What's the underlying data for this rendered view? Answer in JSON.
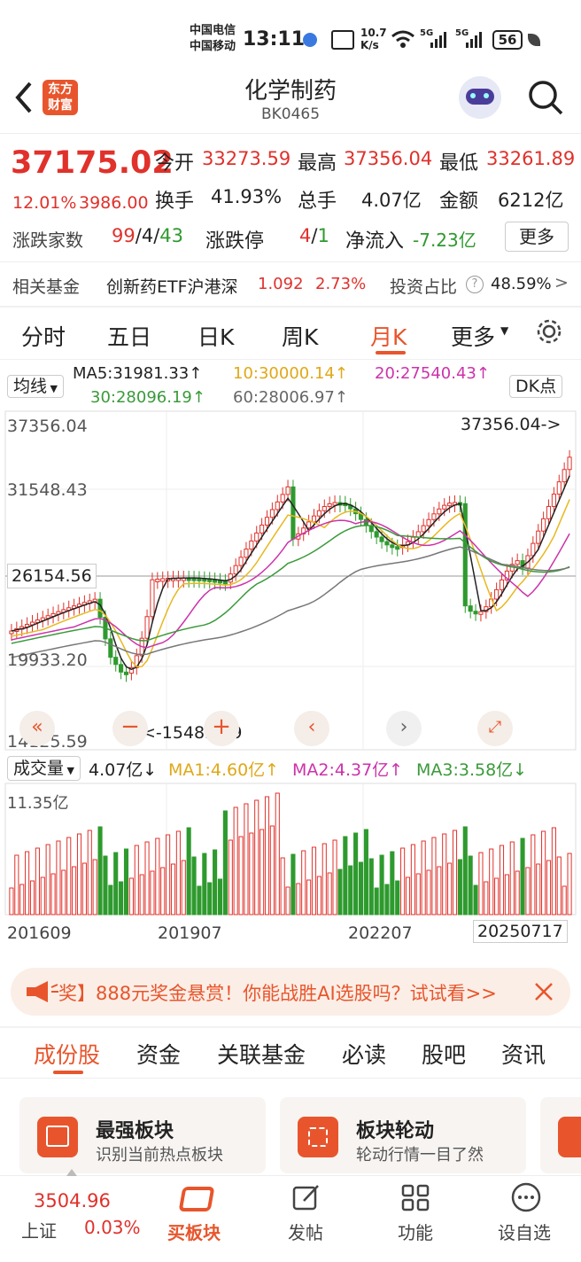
{
  "status": {
    "carrier1": "中国电信",
    "carrier2": "中国移动",
    "time": "13:11",
    "speed_top": "10.7",
    "speed_bottom": "K/s",
    "net1": "5G",
    "net2": "5G",
    "battery": "56"
  },
  "header": {
    "logo_line1": "东方",
    "logo_line2": "财富",
    "title": "化学制药",
    "code": "BK0465"
  },
  "quote": {
    "price": "37175.02",
    "pct": "12.01%",
    "chg": "3986.00",
    "open_label": "今开",
    "open": "33273.59",
    "high_label": "最高",
    "high": "37356.04",
    "low_label": "最低",
    "low": "33261.89",
    "turnover_label": "换手",
    "turnover": "41.93%",
    "volume_label": "总手",
    "volume": "4.07亿",
    "amount_label": "金额",
    "amount": "6212亿",
    "updown_label": "涨跌家数",
    "up": "99",
    "flat": "4",
    "down": "43",
    "limit_label": "涨跌停",
    "limit_up": "4",
    "limit_down": "1",
    "netflow_label": "净流入",
    "netflow": "-7.23亿",
    "more": "更多"
  },
  "fund": {
    "label": "相关基金",
    "name": "创新药ETF沪港深",
    "price": "1.092",
    "pct": "2.73%",
    "ratio_label": "投资占比",
    "ratio": "48.59%",
    "arrow": ">"
  },
  "tabs": [
    "分时",
    "五日",
    "日K",
    "周K",
    "月K",
    "更多"
  ],
  "active_tab": "月K",
  "ma": {
    "selector": "均线",
    "ma5": "MA5:31981.33↑",
    "ma10": "10:30000.14↑",
    "ma20": "20:27540.43↑",
    "ma30": "30:28096.19↑",
    "ma60": "60:28006.97↑",
    "dk": "DK点"
  },
  "chart_data": {
    "type": "candlestick",
    "price_axis": {
      "ticks": [
        "37356.04",
        "31548.43",
        "26154.56",
        "19933.20",
        "14125.59"
      ],
      "max_marker": "37356.04->",
      "min_marker": "<-15483.39"
    },
    "volume_panel": {
      "selector": "成交量",
      "vol": "4.07亿↓",
      "ma1": "MA1:4.60亿↑",
      "ma2": "MA2:4.37亿↑",
      "ma3": "MA3:3.58亿↓",
      "max_label": "11.35亿"
    },
    "x_ticks": [
      "201609",
      "201907",
      "202207",
      "20250717"
    ],
    "colors": {
      "up": "#e0312b",
      "down": "#2e9a2e",
      "ma5": "#222222",
      "ma10": "#e8b820",
      "ma20": "#cc33aa",
      "ma30": "#3a9a3a",
      "ma60": "#777777"
    }
  },
  "banner": {
    "text": "奖】888元奖金悬赏！你能战胜AI选股吗？试试看>>"
  },
  "bottom_tabs": [
    "成份股",
    "资金",
    "关联基金",
    "必读",
    "股吧",
    "资讯"
  ],
  "cards": [
    {
      "title": "最强板块",
      "sub": "识别当前热点板块"
    },
    {
      "title": "板块轮动",
      "sub": "轮动行情一目了然"
    }
  ],
  "navbar": {
    "index_value": "3504.96",
    "index_name": "上证",
    "index_pct": "0.03%",
    "buy": "买板块",
    "post": "发帖",
    "func": "功能",
    "settings": "设自选"
  }
}
